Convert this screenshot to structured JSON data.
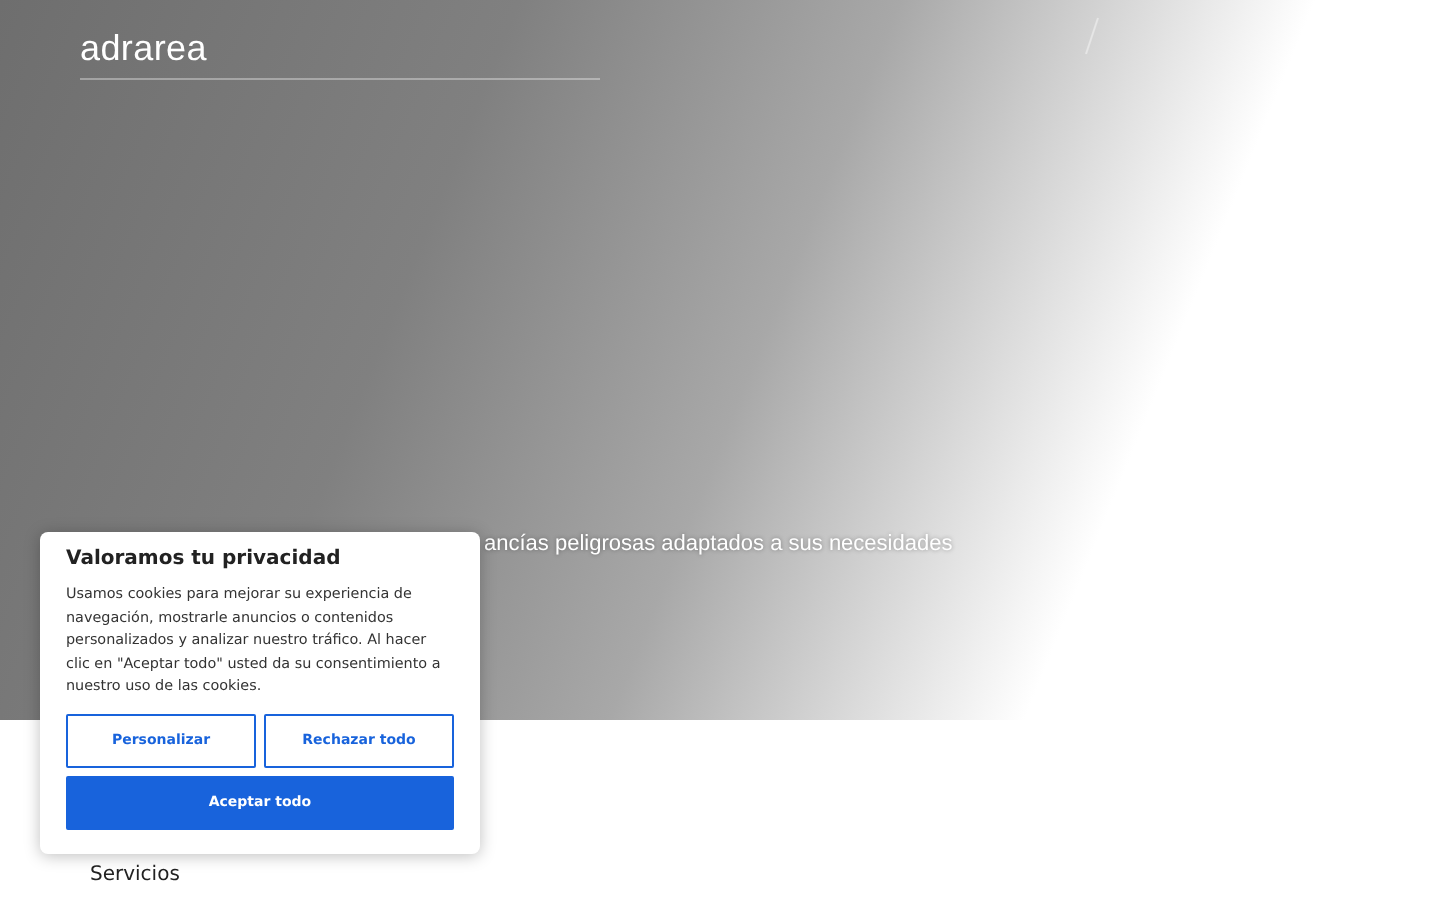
{
  "header": {
    "logo": "adrarea"
  },
  "hero": {
    "subtitle": "ancías peligrosas adaptados a sus necesidades"
  },
  "section": {
    "label": "Servicios"
  },
  "cookie_dialog": {
    "title": "Valoramos tu privacidad",
    "text": "Usamos cookies para mejorar su experiencia de navegación, mostrarle anuncios o contenidos personalizados y analizar nuestro tráfico. Al hacer clic en \"Aceptar todo\" usted da su consentimiento a nuestro uso de las cookies.",
    "buttons": [
      {
        "label": "Personalizar",
        "kind": "outline"
      },
      {
        "label": "Rechazar todo",
        "kind": "outline"
      },
      {
        "label": "Aceptar todo",
        "kind": "primary"
      }
    ]
  }
}
